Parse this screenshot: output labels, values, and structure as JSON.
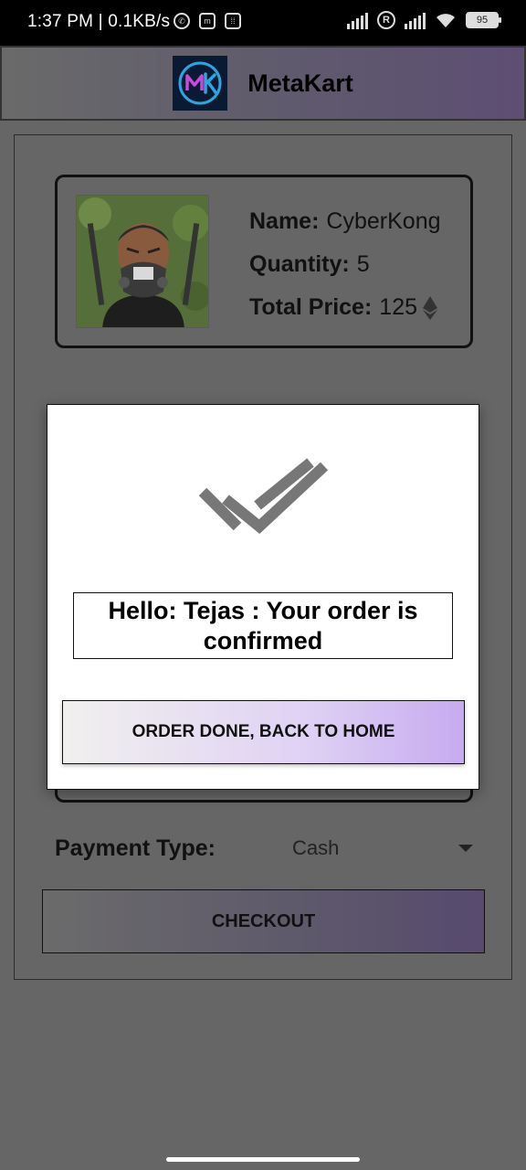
{
  "status_bar": {
    "time": "1:37 PM | 0.1KB/s",
    "battery": "95",
    "icons": [
      "whatsapp-icon",
      "notification-m-icon",
      "grid-icon",
      "signal-icon",
      "r-icon",
      "signal-icon",
      "wifi-icon",
      "battery-icon"
    ]
  },
  "app_bar": {
    "title": "MetaKart",
    "logo": "MK"
  },
  "product": {
    "name_label": "Name:",
    "name_value": "CyberKong",
    "quantity_label": "Quantity:",
    "quantity_value": "5",
    "price_label": "Total Price:",
    "price_value": "125",
    "price_icon": "ethereum-icon"
  },
  "payment": {
    "label": "Payment Type:",
    "value": "Cash"
  },
  "checkout_label": "CHECKOUT",
  "modal": {
    "icon": "double-check-icon",
    "message": "Hello: Tejas :  Your order is confirmed",
    "button_label": "ORDER DONE, BACK TO HOME"
  },
  "colors": {
    "overlay": "#666666",
    "accent_purple": "#c7abef",
    "brand_dark": "#0b1a33"
  }
}
